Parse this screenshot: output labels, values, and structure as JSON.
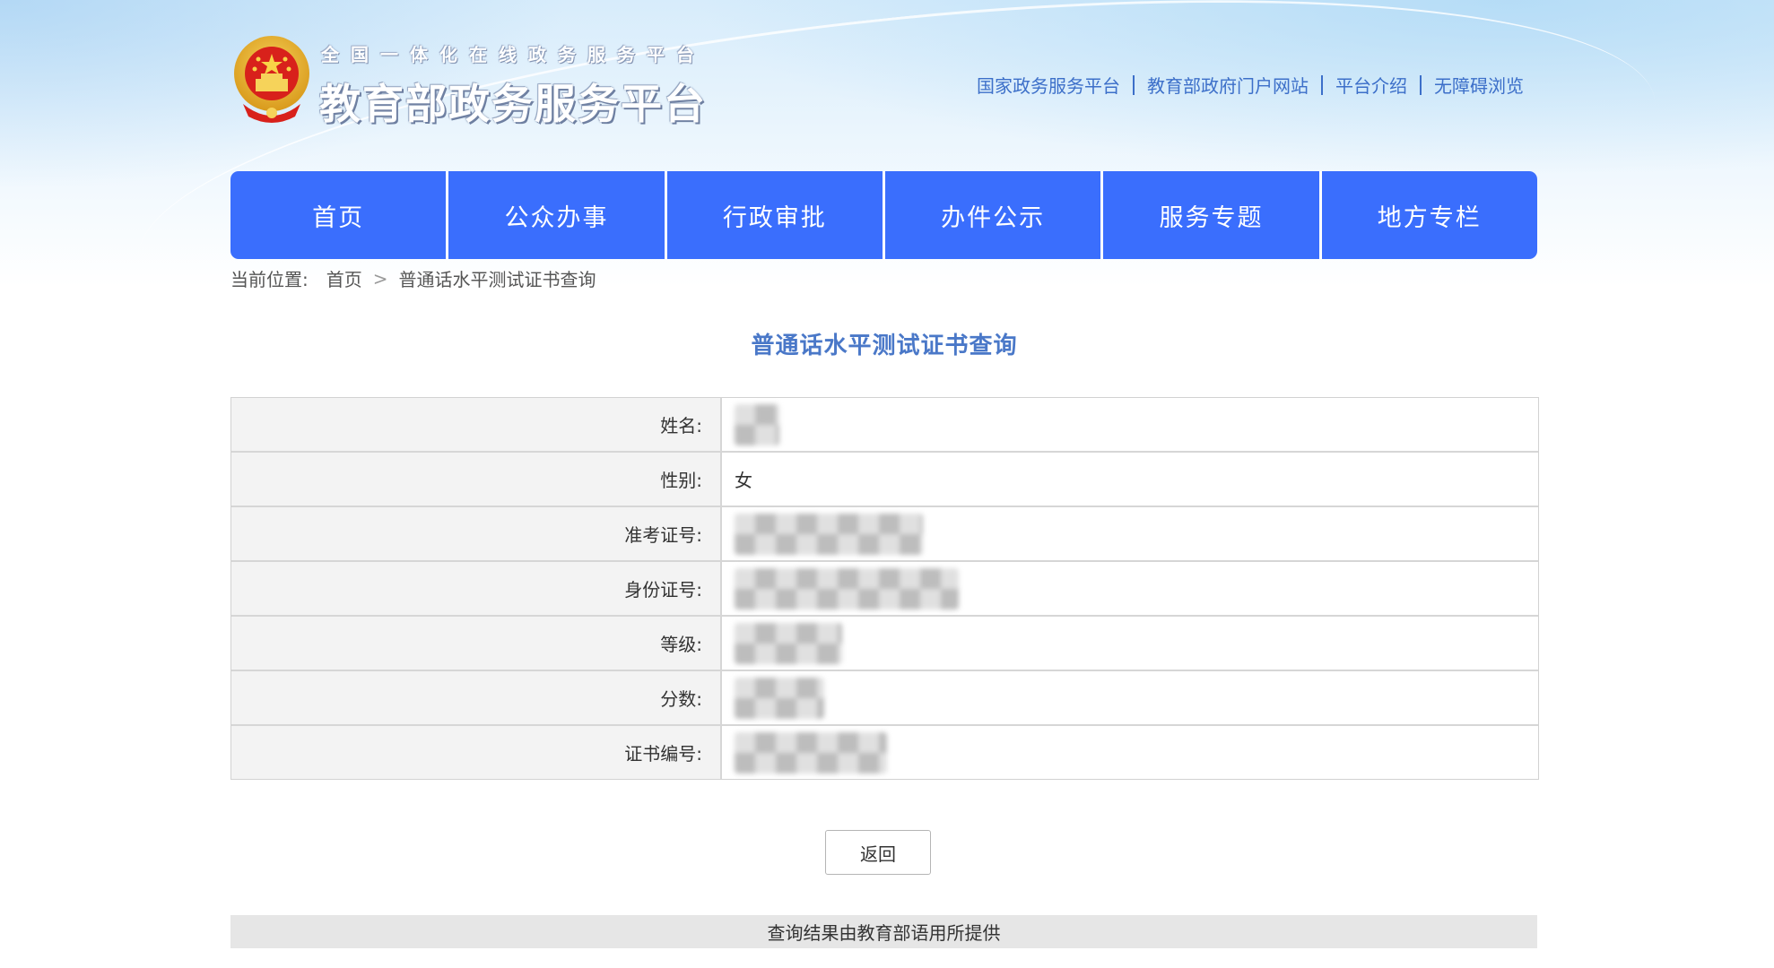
{
  "header": {
    "logo_sub": "全国一体化在线政务服务平台",
    "logo_main": "教育部政务服务平台",
    "links": [
      "国家政务服务平台",
      "教育部政府门户网站",
      "平台介绍",
      "无障碍浏览"
    ]
  },
  "nav": {
    "items": [
      "首页",
      "公众办事",
      "行政审批",
      "办件公示",
      "服务专题",
      "地方专栏"
    ]
  },
  "breadcrumb": {
    "prefix": "当前位置:",
    "home": "首页",
    "arrow": ">",
    "current": "普通话水平测试证书查询"
  },
  "page_title": "普通话水平测试证书查询",
  "result_table": {
    "rows": [
      {
        "label": "姓名:",
        "value": "",
        "masked": true
      },
      {
        "label": "性别:",
        "value": "女",
        "masked": false
      },
      {
        "label": "准考证号:",
        "value": "",
        "masked": true
      },
      {
        "label": "身份证号:",
        "value": "",
        "masked": true
      },
      {
        "label": "等级:",
        "value": "",
        "masked": true
      },
      {
        "label": "分数:",
        "value": "",
        "masked": true
      },
      {
        "label": "证书编号:",
        "value": "",
        "masked": true
      }
    ]
  },
  "back_button": "返回",
  "footer": "查询结果由教育部语用所提供",
  "colors": {
    "nav_blue": "#3a6efd",
    "title_blue": "#4a78c8",
    "link_blue": "#3c6fc9"
  }
}
